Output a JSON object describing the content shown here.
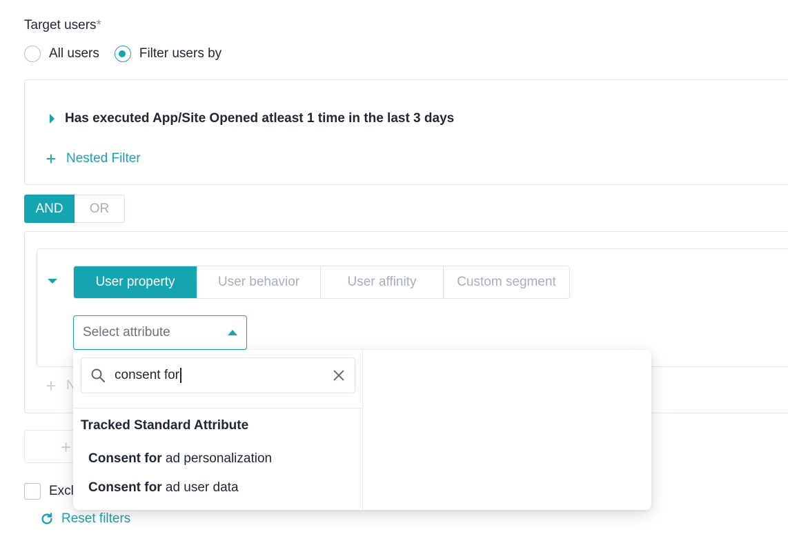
{
  "target": {
    "label": "Target users",
    "required_mark": "*"
  },
  "radios": {
    "all_users": "All users",
    "filter_users_by": "Filter users by",
    "selected": "filter_users_by"
  },
  "filter1": {
    "summary": "Has executed App/Site Opened atleast 1 time in the last 3 days",
    "nested_label": "Nested Filter"
  },
  "logic": {
    "and": "AND",
    "or": "OR",
    "selected": "AND"
  },
  "tabs": [
    {
      "label": "User property",
      "active": true
    },
    {
      "label": "User behavior",
      "active": false
    },
    {
      "label": "User affinity",
      "active": false
    },
    {
      "label": "Custom segment",
      "active": false
    }
  ],
  "select_attr": {
    "placeholder": "Select attribute"
  },
  "dropdown": {
    "search_value": "consent for",
    "section_title": "Tracked Standard Attribute",
    "options": [
      {
        "match": "Consent for",
        "rest": " ad personalization"
      },
      {
        "match": "Consent for",
        "rest": " ad user data"
      }
    ]
  },
  "hidden": {
    "nested_partial": "N",
    "exclude_partial": "Excl"
  },
  "reset": {
    "label": "Reset filters"
  },
  "colors": {
    "accent": "#14a5b0",
    "border": "#dfe3e8",
    "muted": "#a7b0bc"
  }
}
